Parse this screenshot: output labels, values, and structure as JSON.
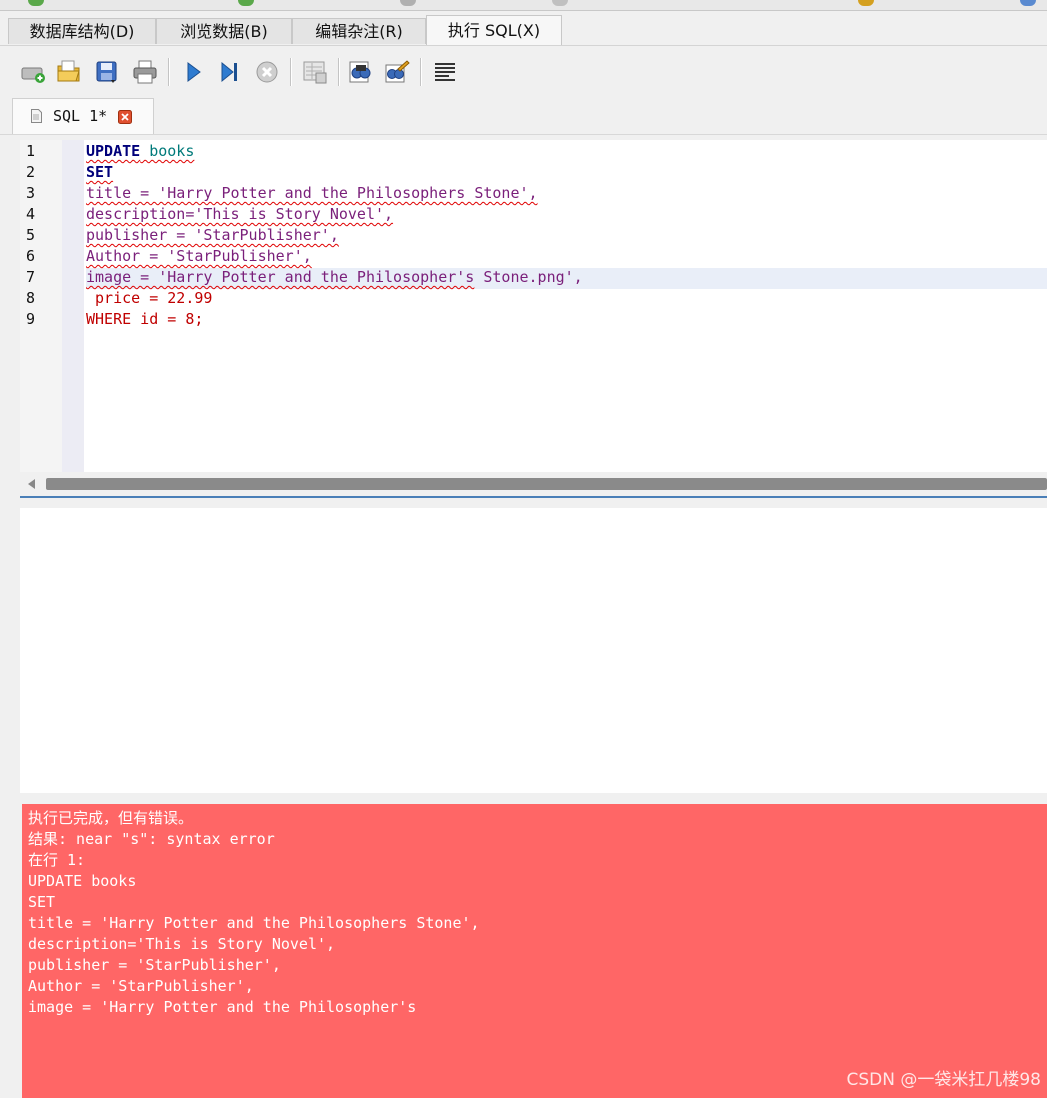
{
  "tabs": [
    {
      "label": "数据库结构(D)",
      "active": false
    },
    {
      "label": "浏览数据(B)",
      "active": false
    },
    {
      "label": "编辑杂注(R)",
      "active": false
    },
    {
      "label": "执行 SQL(X)",
      "active": true
    }
  ],
  "toolbar": {
    "icons": [
      "open-tab-icon",
      "open-sql-file-icon",
      "save-sql-file-icon",
      "print-icon",
      "execute-all-icon",
      "execute-current-line-icon",
      "stop-execution-icon",
      "save-results-icon",
      "find-icon",
      "find-replace-icon",
      "comment-lines-icon"
    ]
  },
  "editor_tab": {
    "label": "SQL 1*"
  },
  "editor": {
    "line_numbers": [
      "1",
      "2",
      "3",
      "4",
      "5",
      "6",
      "7",
      "8",
      "9"
    ],
    "lines": {
      "l1a": "UPDATE",
      "l1b": " books",
      "l2": "SET",
      "l3": "title = 'Harry Potter and the Philosophers Stone',",
      "l4": "description='This is Story Novel',",
      "l5": "publisher = 'StarPublisher',",
      "l6": "Author = 'StarPublisher',",
      "l7a": "image = 'Harry Potter and the Philosopher's",
      "l7b": " Stone.png',",
      "l8": " price = 22.99",
      "l9": "WHERE id = 8;"
    }
  },
  "message": {
    "status": "执行已完成，但有错误。",
    "result": "结果: near \"s\": syntax error",
    "at_line": "在行 1:",
    "sql": [
      "UPDATE books",
      "SET",
      "title = 'Harry Potter and the Philosophers Stone',",
      "description='This is Story Novel',",
      "publisher = 'StarPublisher',",
      "Author = 'StarPublisher',",
      "image = 'Harry Potter and the Philosopher's"
    ]
  },
  "watermark": "CSDN @一袋米扛几楼98",
  "colors": {
    "error_bg": "#ff6666",
    "keyword": "#00007a",
    "string": "#d40000",
    "splitter": "#4a7fb7"
  }
}
